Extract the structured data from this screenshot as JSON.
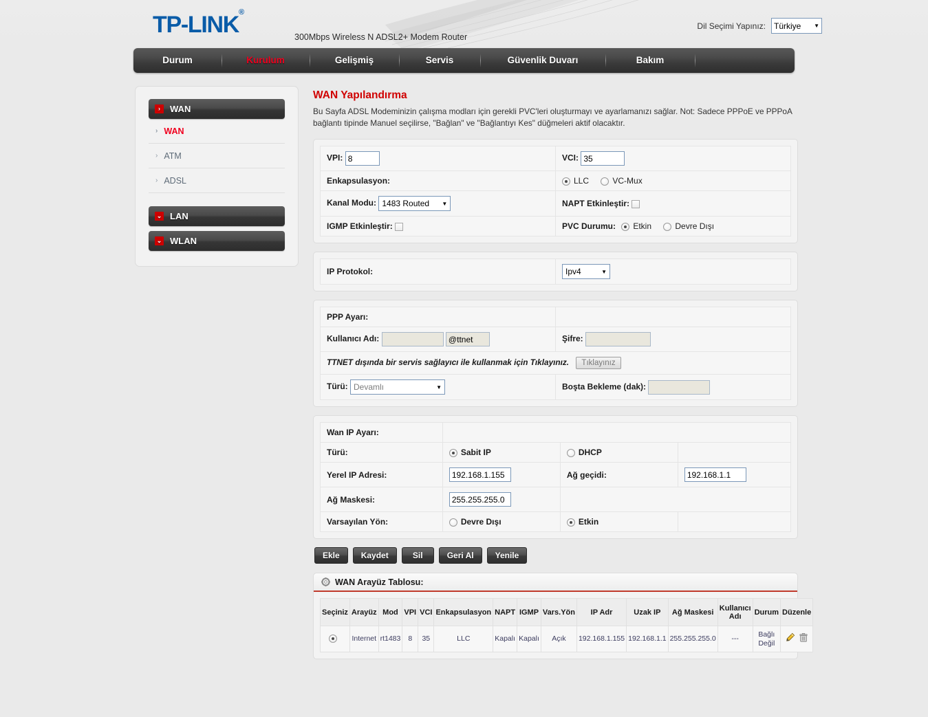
{
  "header": {
    "brand": "TP-LINK",
    "brand_reg": "®",
    "model": "300Mbps Wireless N ADSL2+ Modem Router",
    "lang_label": "Dil Seçimi Yapınız:",
    "lang_value": "Türkiye"
  },
  "nav": {
    "items": [
      {
        "label": "Durum",
        "active": false
      },
      {
        "label": "Kurulum",
        "active": true
      },
      {
        "label": "Gelişmiş",
        "active": false
      },
      {
        "label": "Servis",
        "active": false
      },
      {
        "label": "Güvenlik Duvarı",
        "active": false
      },
      {
        "label": "Bakım",
        "active": false
      }
    ]
  },
  "sidebar": {
    "groups": [
      {
        "label": "WAN",
        "icon": "chevron-right-icon",
        "glyph": "›",
        "items": [
          {
            "label": "WAN",
            "active": true
          },
          {
            "label": "ATM",
            "active": false
          },
          {
            "label": "ADSL",
            "active": false
          }
        ]
      },
      {
        "label": "LAN",
        "icon": "chevron-down-icon",
        "glyph": "⌄",
        "items": []
      },
      {
        "label": "WLAN",
        "icon": "chevron-down-icon",
        "glyph": "⌄",
        "items": []
      }
    ]
  },
  "main": {
    "title": "WAN Yapılandırma",
    "description": "Bu Sayfa ADSL Modeminizin çalışma modları için gerekli PVC'leri oluşturmayı ve ayarlamanızı sağlar. Not: Sadece PPPoE ve PPPoA bağlantı tipinde Manuel seçilirse, \"Bağlan\" ve \"Bağlantıyı Kes\" düğmeleri aktif olacaktır."
  },
  "atm": {
    "vpi_label": "VPI:",
    "vpi_value": "8",
    "vci_label": "VCI:",
    "vci_value": "35",
    "encap_label": "Enkapsulasyon:",
    "encap_llc": "LLC",
    "encap_vcmux": "VC-Mux",
    "encap_selected": "LLC",
    "channel_label": "Kanal Modu:",
    "channel_value": "1483 Routed",
    "napt_label": "NAPT Etkinleştir:",
    "napt_checked": false,
    "igmp_label": "IGMP Etkinleştir:",
    "igmp_checked": false,
    "pvc_label": "PVC Durumu:",
    "pvc_enable": "Etkin",
    "pvc_disable": "Devre Dışı",
    "pvc_selected": "Etkin"
  },
  "ip_protocol": {
    "label": "IP Protokol:",
    "value": "Ipv4"
  },
  "ppp": {
    "section_label": "PPP Ayarı:",
    "username_label": "Kullanıcı Adı:",
    "username_value": "",
    "domain_value": "@ttnet",
    "password_label": "Şifre:",
    "password_value": "",
    "note": "TTNET dışında bir servis sağlayıcı ile kullanmak için Tıklayınız.",
    "note_button": "Tıklayınız",
    "type_label": "Türü:",
    "type_value": "Devamlı",
    "idle_label": "Boşta Bekleme (dak):",
    "idle_value": ""
  },
  "wan_ip": {
    "section_label": "Wan IP Ayarı:",
    "type_label": "Türü:",
    "type_static": "Sabit IP",
    "type_dhcp": "DHCP",
    "type_selected": "Sabit IP",
    "local_ip_label": "Yerel IP Adresi:",
    "local_ip_value": "192.168.1.155",
    "gateway_label": "Ağ geçidi:",
    "gateway_value": "192.168.1.1",
    "netmask_label": "Ağ Maskesi:",
    "netmask_value": "255.255.255.0",
    "default_route_label": "Varsayılan Yön:",
    "default_route_disable": "Devre Dışı",
    "default_route_enable": "Etkin",
    "default_route_selected": "Etkin"
  },
  "actions": [
    {
      "label": "Ekle"
    },
    {
      "label": "Kaydet"
    },
    {
      "label": "Sil"
    },
    {
      "label": "Geri Al"
    },
    {
      "label": "Yenile"
    }
  ],
  "wan_table": {
    "title": "WAN Arayüz Tablosu:",
    "icon": "gear-icon",
    "columns": [
      "Seçiniz",
      "Arayüz",
      "Mod",
      "VPI",
      "VCI",
      "Enkapsulasyon",
      "NAPT",
      "IGMP",
      "Vars.Yön",
      "IP Adr",
      "Uzak IP",
      "Ağ Maskesi",
      "Kullanıcı Adı",
      "Durum",
      "Düzenle"
    ],
    "rows": [
      {
        "selected": true,
        "interface": "Internet",
        "mode": "rt1483",
        "vpi": "8",
        "vci": "35",
        "encapsulation": "LLC",
        "napt": "Kapalı",
        "igmp": "Kapalı",
        "default_route": "Açık",
        "ip_address": "192.168.1.155",
        "remote_ip": "192.168.1.1",
        "netmask": "255.255.255.0",
        "username": "---",
        "status": "Bağlı Değil",
        "edit_icons": [
          "pencil-icon",
          "trash-icon"
        ]
      }
    ]
  },
  "colors": {
    "brand_blue": "#0a5ca8",
    "accent_red": "#f0001e",
    "title_red": "#d00000",
    "page_bg": "#eaeaea",
    "nav_dark": "#3a3a3a"
  }
}
